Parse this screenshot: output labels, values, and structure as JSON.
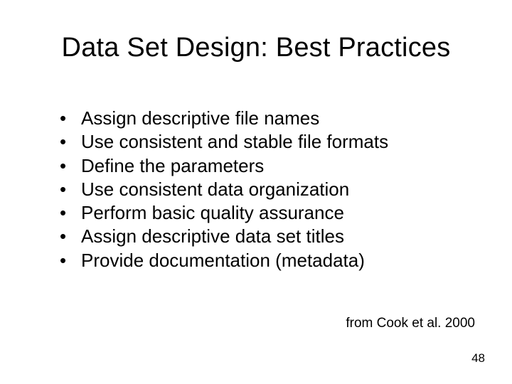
{
  "title": "Data Set Design: Best Practices",
  "bullets": [
    "Assign descriptive file names",
    "Use consistent and stable file formats",
    "Define the parameters",
    "Use consistent data organization",
    "Perform basic quality assurance",
    "Assign descriptive data set titles",
    "Provide documentation (metadata)"
  ],
  "citation": "from Cook et al. 2000",
  "page_number": "48"
}
